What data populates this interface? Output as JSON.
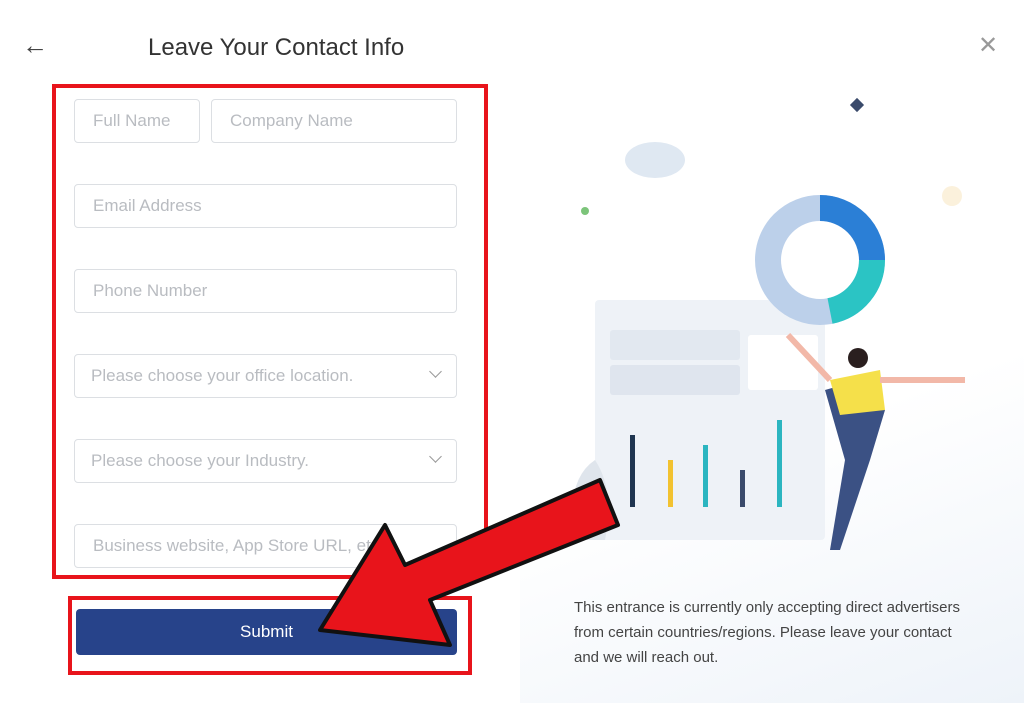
{
  "header": {
    "title": "Leave Your Contact Info",
    "back_icon": "arrow-left-icon",
    "close_icon": "close-icon"
  },
  "form": {
    "full_name": {
      "placeholder": "Full Name",
      "value": ""
    },
    "company_name": {
      "placeholder": "Company Name",
      "value": ""
    },
    "email": {
      "placeholder": "Email Address",
      "value": ""
    },
    "phone": {
      "placeholder": "Phone Number",
      "value": ""
    },
    "office_location": {
      "placeholder": "Please choose your office location."
    },
    "industry": {
      "placeholder": "Please choose your Industry."
    },
    "website": {
      "placeholder": "Business website, App Store URL, etc.",
      "value": ""
    },
    "submit_label": "Submit"
  },
  "note": "This entrance is currently only accepting direct advertisers from certain countries/regions. Please leave your contact and we will reach out.",
  "annotation_color": "#e8141b",
  "accent": "#27438a"
}
